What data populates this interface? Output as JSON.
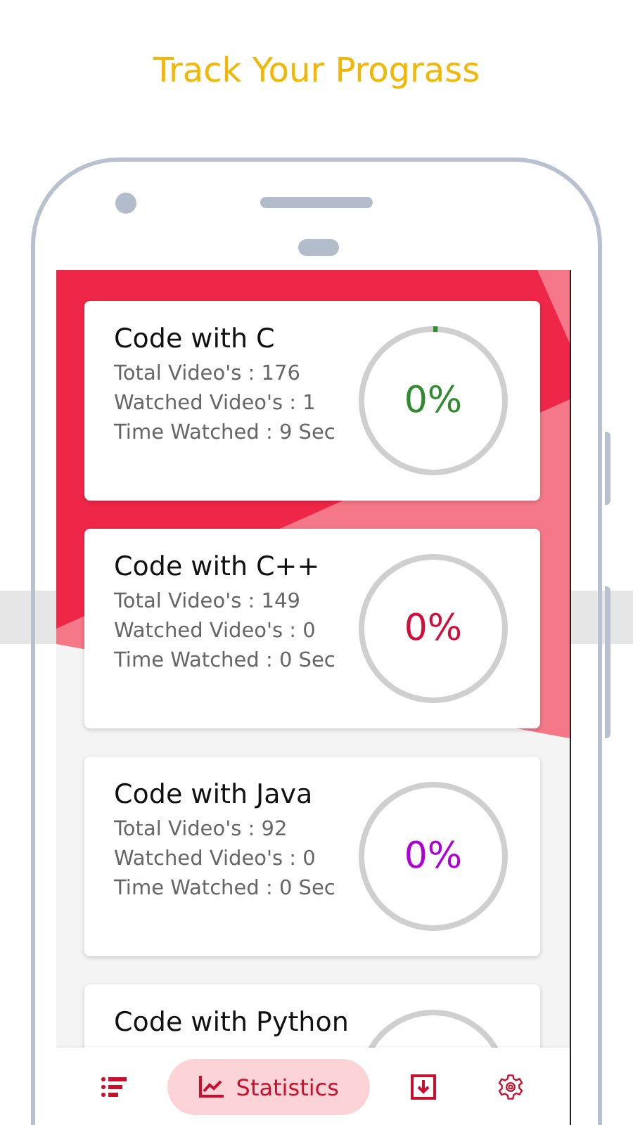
{
  "heading": "Track Your Prograss",
  "courses": [
    {
      "title": "Code with C",
      "stats": [
        "Total Video's : 176",
        "Watched Video's : 1",
        "Time Watched : 9 Sec"
      ],
      "percent": "0%",
      "color": "#2e8b2e",
      "level": 0.01
    },
    {
      "title": "Code with C++",
      "stats": [
        "Total Video's : 149",
        "Watched Video's : 0",
        "Time Watched : 0 Sec"
      ],
      "percent": "0%",
      "color": "#d0103a"
    },
    {
      "title": "Code with Java",
      "stats": [
        "Total Video's : 92",
        "Watched Video's : 0",
        "Time Watched : 0 Sec"
      ],
      "percent": "0%",
      "color": "#b000d8"
    },
    {
      "title": "Code with Python"
    }
  ],
  "nav": [
    {
      "kind": "list",
      "selected": false
    },
    {
      "kind": "chart",
      "label": "Statistics",
      "selected": true
    },
    {
      "kind": "download",
      "selected": false
    },
    {
      "kind": "settings",
      "selected": false
    }
  ]
}
